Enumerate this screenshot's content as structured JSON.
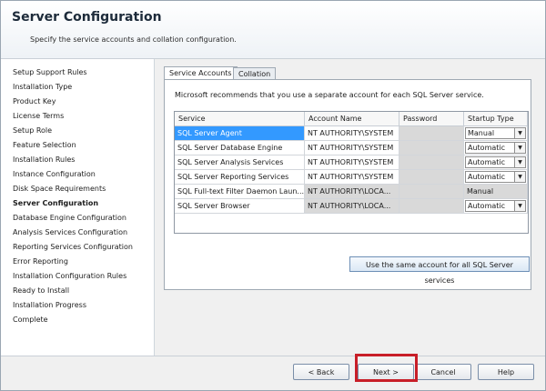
{
  "window": {
    "title": "Server Configuration",
    "subtitle": "Specify the service accounts and collation configuration."
  },
  "sidebar": {
    "items": [
      {
        "label": "Setup Support Rules"
      },
      {
        "label": "Installation Type"
      },
      {
        "label": "Product Key"
      },
      {
        "label": "License Terms"
      },
      {
        "label": "Setup Role"
      },
      {
        "label": "Feature Selection"
      },
      {
        "label": "Installation Rules"
      },
      {
        "label": "Instance Configuration"
      },
      {
        "label": "Disk Space Requirements"
      },
      {
        "label": "Server Configuration",
        "active": true
      },
      {
        "label": "Database Engine Configuration"
      },
      {
        "label": "Analysis Services Configuration"
      },
      {
        "label": "Reporting Services Configuration"
      },
      {
        "label": "Error Reporting"
      },
      {
        "label": "Installation Configuration Rules"
      },
      {
        "label": "Ready to Install"
      },
      {
        "label": "Installation Progress"
      },
      {
        "label": "Complete"
      }
    ]
  },
  "tabs": [
    {
      "label": "Service Accounts",
      "active": true
    },
    {
      "label": "Collation",
      "active": false
    }
  ],
  "panel": {
    "note": "Microsoft recommends that you use a separate account for each SQL Server service."
  },
  "grid": {
    "headers": [
      "Service",
      "Account Name",
      "Password",
      "Startup Type"
    ],
    "rows": [
      {
        "service": "SQL Server Agent",
        "account": "NT AUTHORITY\\SYSTEM",
        "password": "",
        "startup": "Manual"
      },
      {
        "service": "SQL Server Database Engine",
        "account": "NT AUTHORITY\\SYSTEM",
        "password": "",
        "startup": "Automatic"
      },
      {
        "service": "SQL Server Analysis Services",
        "account": "NT AUTHORITY\\SYSTEM",
        "password": "",
        "startup": "Automatic"
      },
      {
        "service": "SQL Server Reporting Services",
        "account": "NT AUTHORITY\\SYSTEM",
        "password": "",
        "startup": "Automatic"
      },
      {
        "service": "SQL Full-text Filter Daemon Laun...",
        "account": "NT AUTHORITY\\LOCA...",
        "password": "",
        "startup": "Manual"
      },
      {
        "service": "SQL Server Browser",
        "account": "NT AUTHORITY\\LOCA...",
        "password": "",
        "startup": "Automatic"
      }
    ]
  },
  "buttons": {
    "same_account": "Use the same account for all SQL Server services",
    "back": "< Back",
    "next": "Next >",
    "cancel": "Cancel",
    "help": "Help"
  },
  "colors": {
    "highlight": "#c81e28",
    "selection": "#3399ff"
  },
  "icons": {
    "dropdown": "chevron-down-icon"
  }
}
